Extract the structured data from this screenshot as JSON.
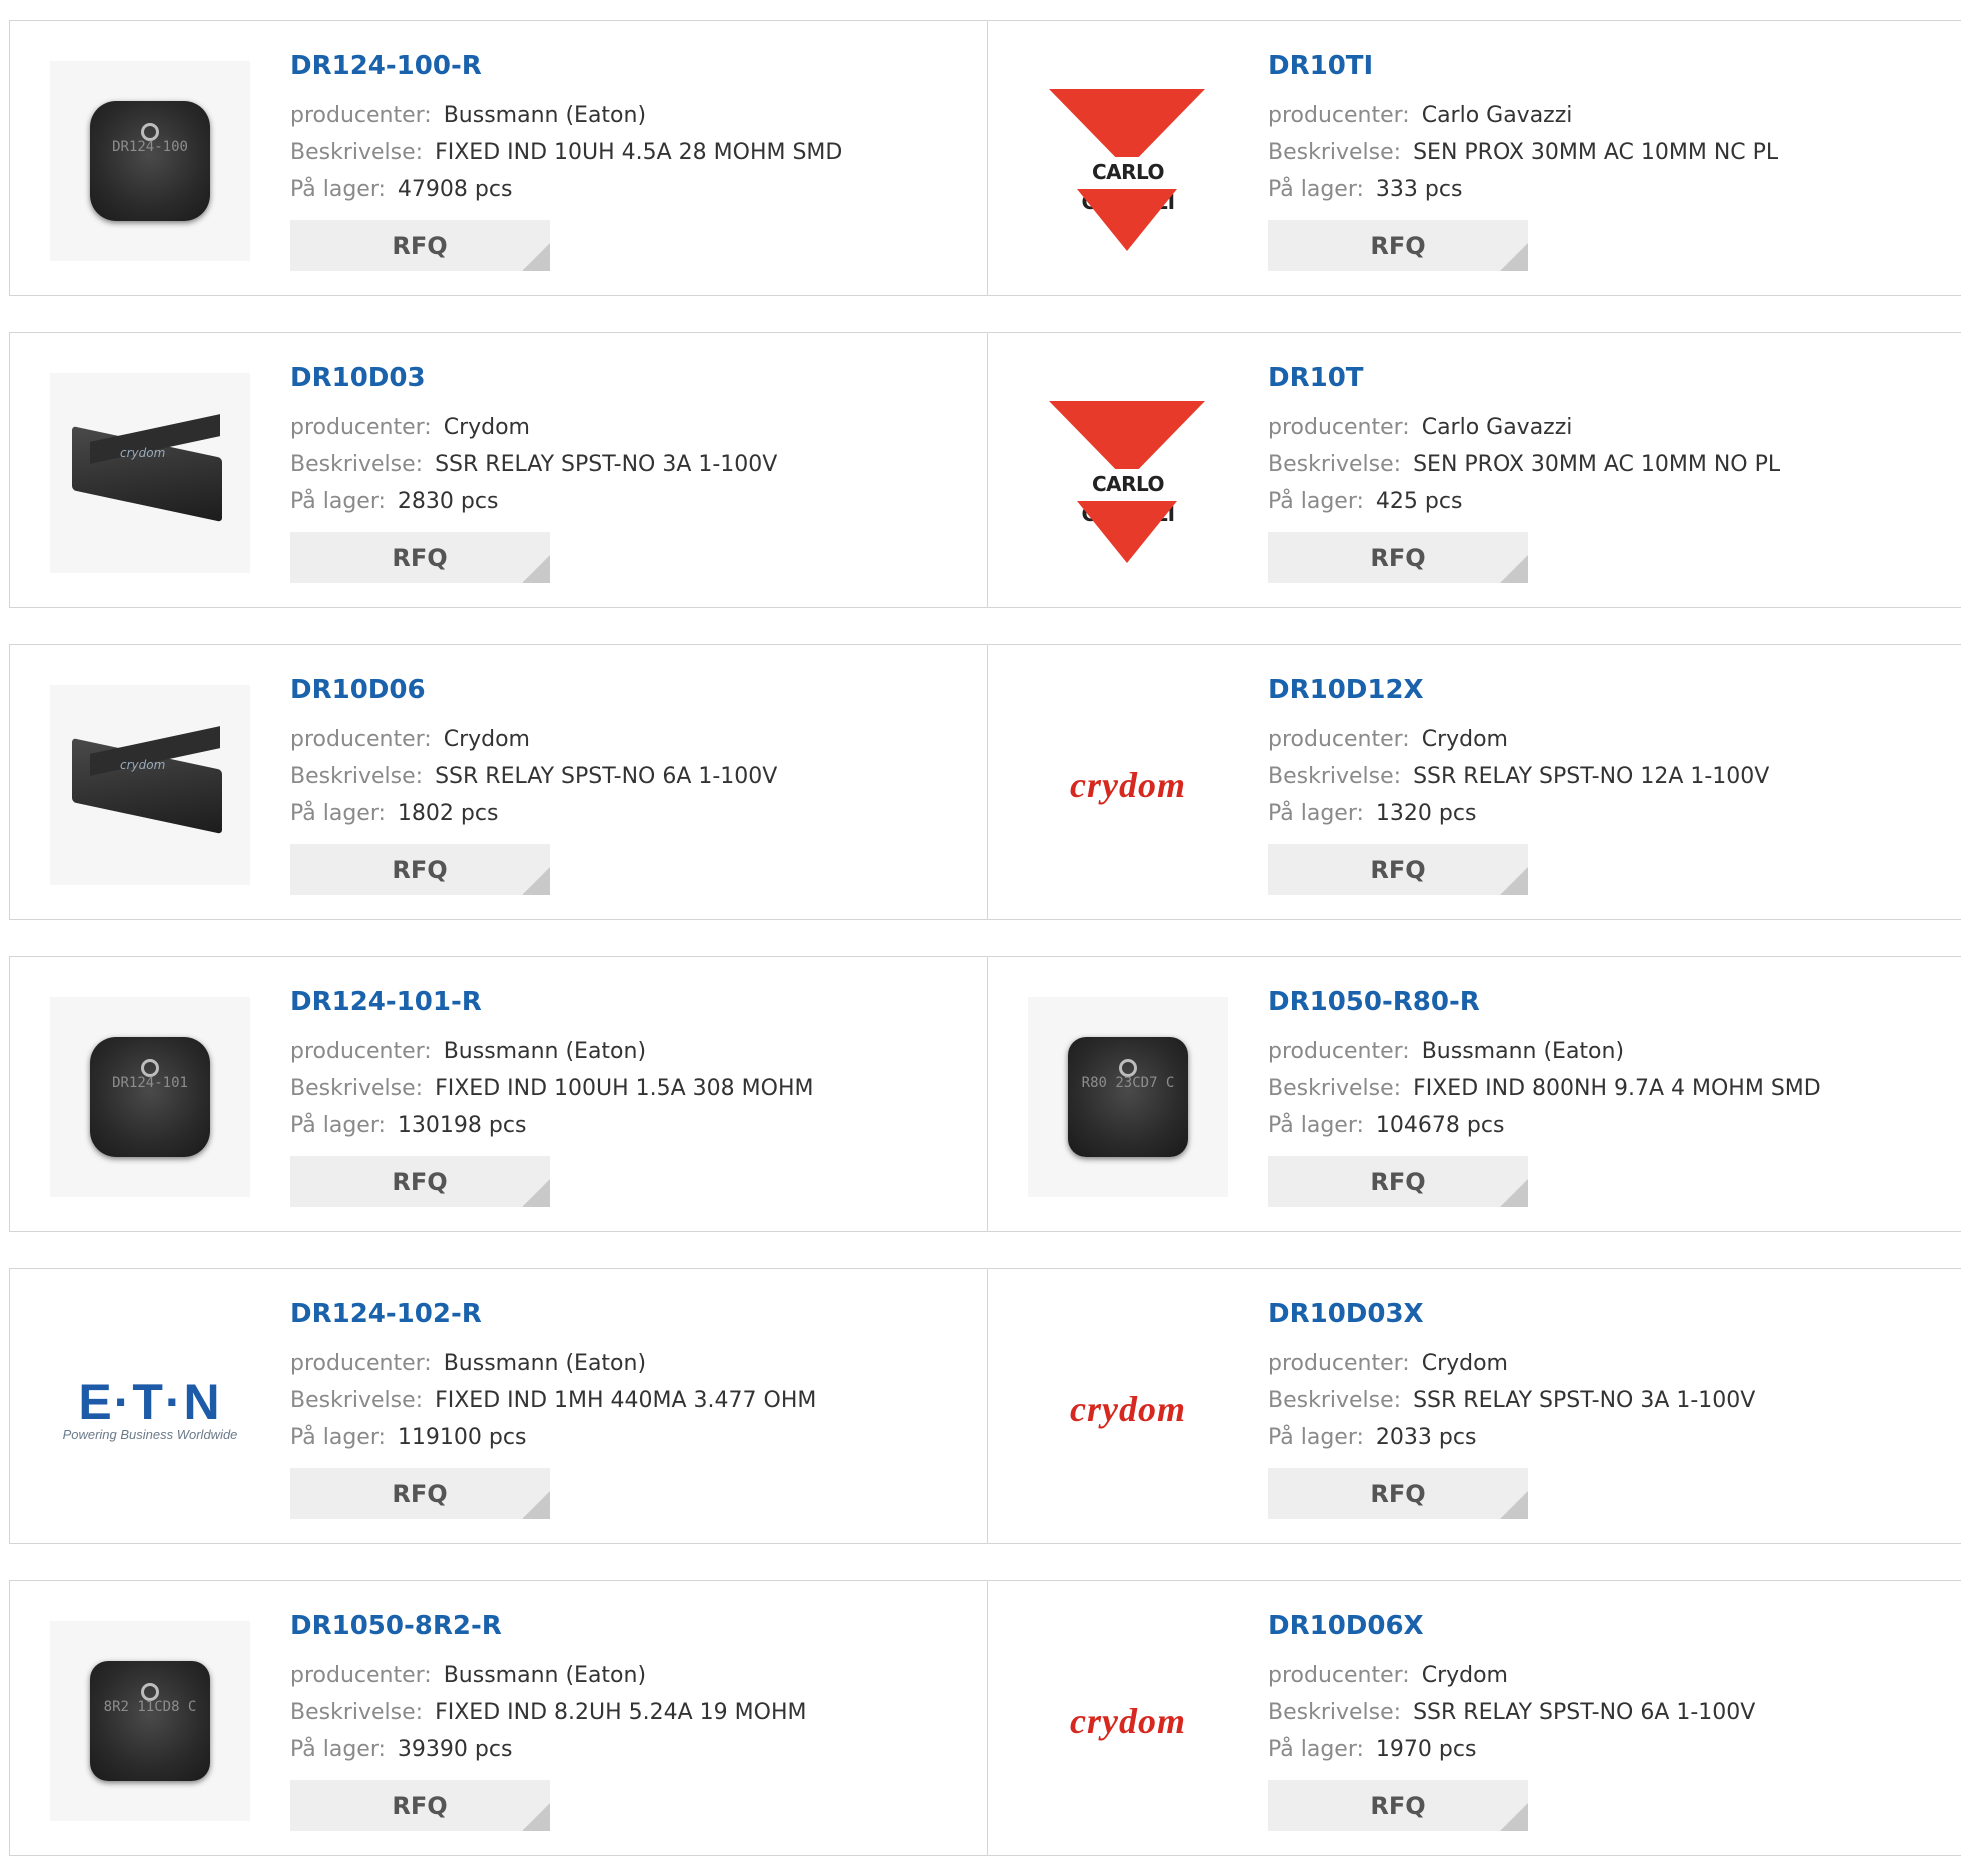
{
  "labels": {
    "manufacturer": "producenter:",
    "description": "Beskrivelse:",
    "stock": "På lager:",
    "rfq": "RFQ"
  },
  "products": [
    {
      "part": "DR124-100-R",
      "manufacturer": "Bussmann (Eaton)",
      "description": "FIXED IND 10UH 4.5A 28 MOHM SMD",
      "stock": "47908 pcs",
      "image": "inductor-dr124-100",
      "image_text": "DR124-100"
    },
    {
      "part": "DR10TI",
      "manufacturer": "Carlo Gavazzi",
      "description": "SEN PROX 30MM AC 10MM NC PL",
      "stock": "333 pcs",
      "image": "carlo-gavazzi-logo",
      "image_text": "CARLO GAVAZZI"
    },
    {
      "part": "DR10D03",
      "manufacturer": "Crydom",
      "description": "SSR RELAY SPST-NO 3A 1-100V",
      "stock": "2830 pcs",
      "image": "relay-photo",
      "image_text": "crydom"
    },
    {
      "part": "DR10T",
      "manufacturer": "Carlo Gavazzi",
      "description": "SEN PROX 30MM AC 10MM NO PL",
      "stock": "425 pcs",
      "image": "carlo-gavazzi-logo",
      "image_text": "CARLO GAVAZZI"
    },
    {
      "part": "DR10D06",
      "manufacturer": "Crydom",
      "description": "SSR RELAY SPST-NO 6A 1-100V",
      "stock": "1802 pcs",
      "image": "relay-photo",
      "image_text": "crydom"
    },
    {
      "part": "DR10D12X",
      "manufacturer": "Crydom",
      "description": "SSR RELAY SPST-NO 12A 1-100V",
      "stock": "1320 pcs",
      "image": "crydom-logo",
      "image_text": "crydom"
    },
    {
      "part": "DR124-101-R",
      "manufacturer": "Bussmann (Eaton)",
      "description": "FIXED IND 100UH 1.5A 308 MOHM",
      "stock": "130198 pcs",
      "image": "inductor-dr124-101",
      "image_text": "DR124-101"
    },
    {
      "part": "DR1050-R80-R",
      "manufacturer": "Bussmann (Eaton)",
      "description": "FIXED IND 800NH 9.7A 4 MOHM SMD",
      "stock": "104678 pcs",
      "image": "inductor-dr1050-r80",
      "image_text": "R80 23CD7 C"
    },
    {
      "part": "DR124-102-R",
      "manufacturer": "Bussmann (Eaton)",
      "description": "FIXED IND 1MH 440MA 3.477 OHM",
      "stock": "119100 pcs",
      "image": "eaton-logo",
      "image_text": "E·T·N",
      "image_subtext": "Powering Business Worldwide"
    },
    {
      "part": "DR10D03X",
      "manufacturer": "Crydom",
      "description": "SSR RELAY SPST-NO 3A 1-100V",
      "stock": "2033 pcs",
      "image": "crydom-logo",
      "image_text": "crydom"
    },
    {
      "part": "DR1050-8R2-R",
      "manufacturer": "Bussmann (Eaton)",
      "description": "FIXED IND 8.2UH 5.24A 19 MOHM",
      "stock": "39390 pcs",
      "image": "inductor-dr1050-8r2",
      "image_text": "8R2 11CD8 C"
    },
    {
      "part": "DR10D06X",
      "manufacturer": "Crydom",
      "description": "SSR RELAY SPST-NO 6A 1-100V",
      "stock": "1970 pcs",
      "image": "crydom-logo",
      "image_text": "crydom"
    }
  ]
}
